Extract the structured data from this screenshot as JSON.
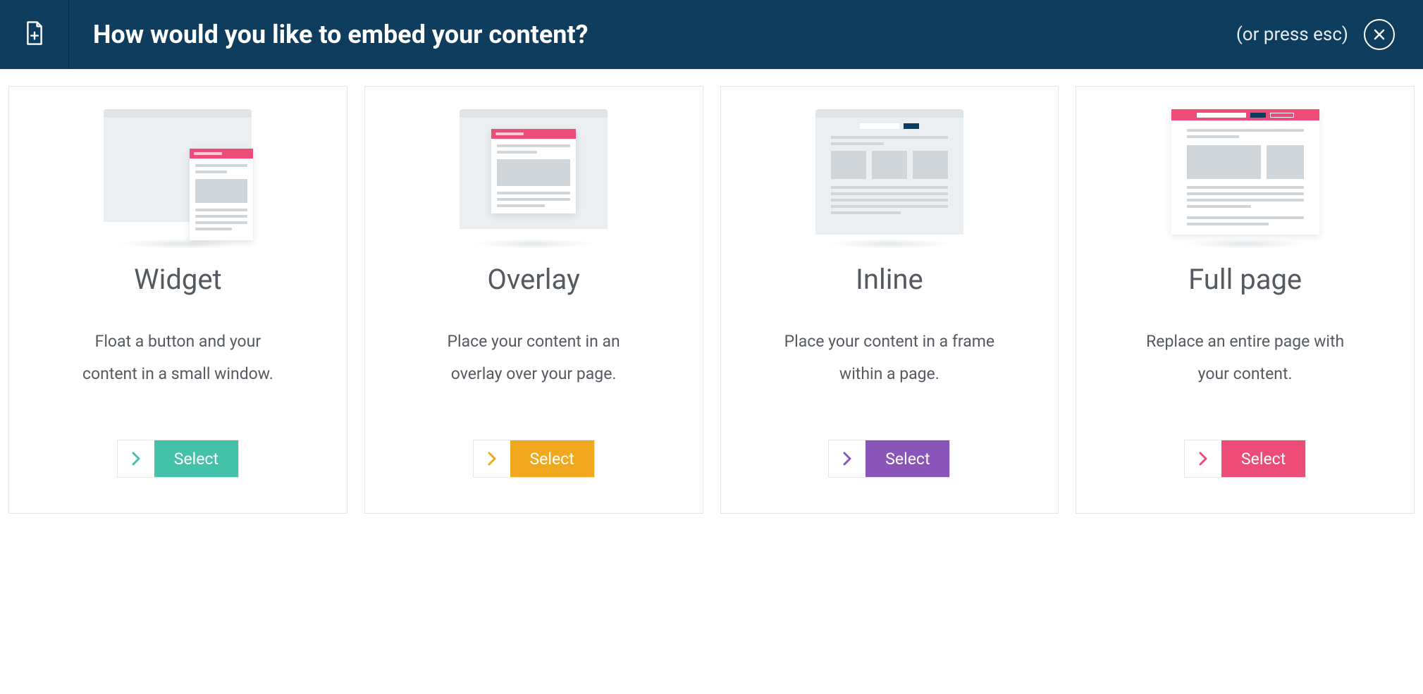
{
  "header": {
    "title": "How would you like to embed your content?",
    "esc_hint": "(or press esc)"
  },
  "cards": [
    {
      "title": "Widget",
      "desc": "Float a button and your content in a small window.",
      "button": "Select"
    },
    {
      "title": "Overlay",
      "desc": "Place your content in an overlay over your page.",
      "button": "Select"
    },
    {
      "title": "Inline",
      "desc": "Place your content in a frame within a page.",
      "button": "Select"
    },
    {
      "title": "Full page",
      "desc": "Replace an entire page with your content.",
      "button": "Select"
    }
  ],
  "colors": {
    "header_bg": "#0e3d5d",
    "teal": "#44c1a9",
    "orange": "#f0a81e",
    "purple": "#8a55b8",
    "pink": "#ed4c78"
  }
}
